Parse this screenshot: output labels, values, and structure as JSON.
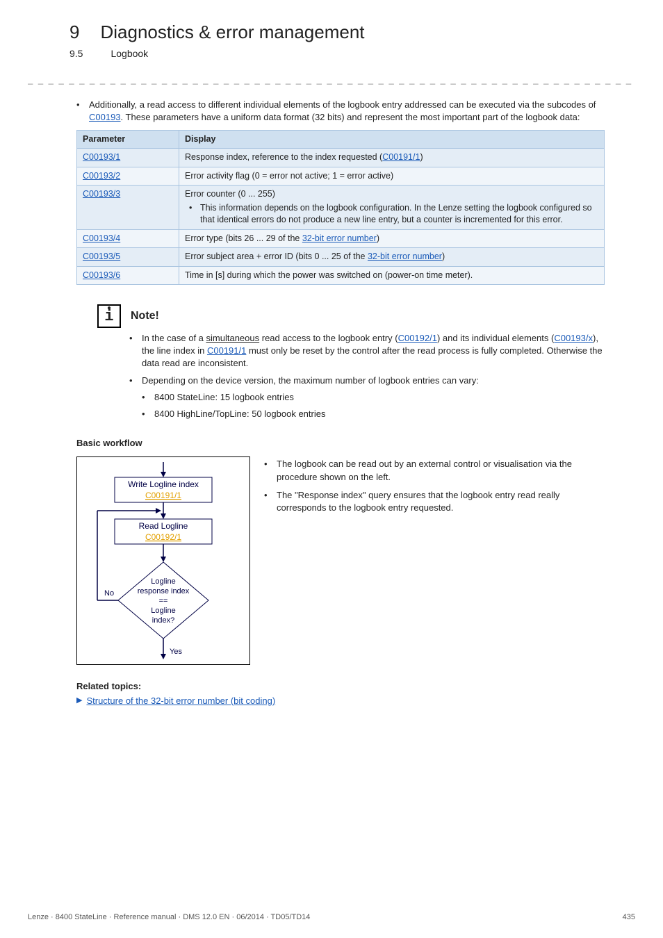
{
  "header": {
    "chapter_number": "9",
    "chapter_title": "Diagnostics & error management",
    "section_number": "9.5",
    "section_title": "Logbook",
    "dashes": "_ _ _ _ _ _ _ _ _ _ _ _ _ _ _ _ _ _ _ _ _ _ _ _ _ _ _ _ _ _ _ _ _ _ _ _ _ _ _ _ _ _ _ _ _ _ _ _ _ _ _ _ _ _ _ _ _ _ _ _ _ _ _ _"
  },
  "intro": {
    "bullet_pre": "Additionally, a read access to different individual elements of the logbook entry addressed can be executed via the subcodes of ",
    "link_c00193": "C00193",
    "bullet_post": ". These parameters have a uniform data format (32 bits) and represent the most important part of the logbook data:"
  },
  "table": {
    "head_param": "Parameter",
    "head_display": "Display",
    "rows": [
      {
        "param": "C00193/1",
        "display_pre": "Response index, reference to the index requested (",
        "display_link": "C00191/1",
        "display_post": ")"
      },
      {
        "param": "C00193/2",
        "display_full": "Error activity flag (0 = error not active; 1 = error active)"
      },
      {
        "param": "C00193/3",
        "line1": "Error counter (0 ... 255)",
        "sub": "This information depends on the logbook configuration. In the Lenze setting the logbook configured so that identical errors do not produce a new line entry, but a counter is incremented for this error."
      },
      {
        "param": "C00193/4",
        "display_pre": "Error type (bits 26 ... 29 of the ",
        "display_link": "32-bit error number",
        "display_post": ")"
      },
      {
        "param": "C00193/5",
        "display_pre": "Error subject area + error ID (bits 0 ... 25 of the ",
        "display_link": "32-bit error number",
        "display_post": ")"
      },
      {
        "param": "C00193/6",
        "display_full": "Time in [s] during which the power was switched on (power-on time meter)."
      }
    ]
  },
  "note": {
    "icon_glyph": "i",
    "title": "Note!",
    "b1_pre": "In the case of a ",
    "b1_u": "simultaneous",
    "b1_mid1": " read access to the logbook entry (",
    "b1_link1": "C00192/1",
    "b1_mid2": ") and its individual elements (",
    "b1_link2": "C00193/x",
    "b1_mid3": "), the line index in ",
    "b1_link3": "C00191/1",
    "b1_post": " must only be reset by the control after the read process is fully completed. Otherwise the data read are inconsistent.",
    "b2": "Depending on the device version, the maximum number of logbook entries can vary:",
    "sub1": "8400 StateLine: 15 logbook entries",
    "sub2": "8400 HighLine/TopLine: 50 logbook entries"
  },
  "workflow": {
    "heading": "Basic workflow",
    "box1_line1": "Write Logline index",
    "box1_link": "C00191/1",
    "box2_line1": "Read Logline",
    "box2_link": "C00192/1",
    "diamond_l1": "Logline",
    "diamond_l2": "response index",
    "diamond_l3": "==",
    "diamond_l4": "Logline",
    "diamond_l5": "index?",
    "no": "No",
    "yes": "Yes",
    "right1": "The logbook can be read out by an external control or visualisation via the procedure shown on the left.",
    "right2": "The \"Response index\" query ensures that the logbook entry read really corresponds to the logbook entry requested."
  },
  "related": {
    "heading": "Related topics:",
    "arrow": "▶",
    "link": "Structure of the 32-bit error number (bit coding)"
  },
  "footer": {
    "left": "Lenze · 8400 StateLine · Reference manual · DMS 12.0 EN · 06/2014 · TD05/TD14",
    "right": "435"
  },
  "chart_data": {
    "type": "table",
    "title": "Logbook subcode parameters of C00193",
    "columns": [
      "Parameter",
      "Display"
    ],
    "rows": [
      [
        "C00193/1",
        "Response index, reference to the index requested (C00191/1)"
      ],
      [
        "C00193/2",
        "Error activity flag (0 = error not active; 1 = error active)"
      ],
      [
        "C00193/3",
        "Error counter (0 ... 255). This information depends on the logbook configuration. In the Lenze setting the logbook configured so that identical errors do not produce a new line entry, but a counter is incremented for this error."
      ],
      [
        "C00193/4",
        "Error type (bits 26 ... 29 of the 32-bit error number)"
      ],
      [
        "C00193/5",
        "Error subject area + error ID (bits 0 ... 25 of the 32-bit error number)"
      ],
      [
        "C00193/6",
        "Time in [s] during which the power was switched on (power-on time meter)."
      ]
    ]
  }
}
